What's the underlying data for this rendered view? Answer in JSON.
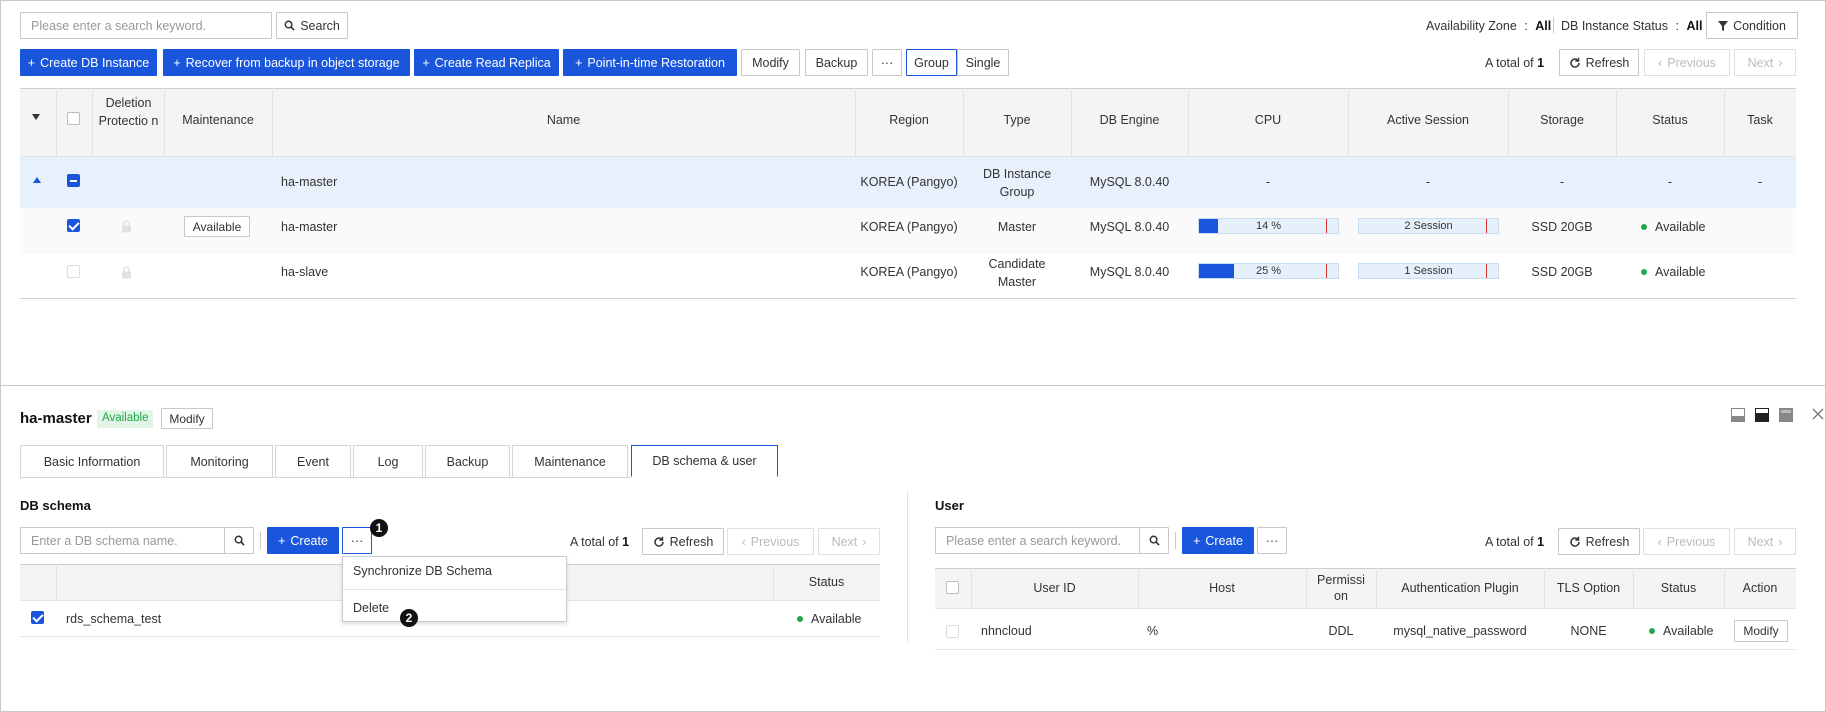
{
  "toolbar": {
    "search_placeholder": "Please enter a search keyword.",
    "search_label": "Search",
    "az_label": "Availability Zone",
    "az_value": "All",
    "status_filter_label": "DB Instance Status",
    "status_filter_value": "All",
    "condition_label": "Condition",
    "sep": ":",
    "create_db_instance": "Create DB Instance",
    "recover_backup": "Recover from backup in object storage",
    "create_read_replica": "Create Read Replica",
    "pitr": "Point-in-time Restoration",
    "modify": "Modify",
    "backup": "Backup",
    "more": "···",
    "group": "Group",
    "single": "Single",
    "total_prefix": "A total of",
    "total_count": "1",
    "refresh": "Refresh",
    "previous": "Previous",
    "next": "Next"
  },
  "table": {
    "headers": {
      "deletion_protection": "Deletion Protectio n",
      "maintenance": "Maintenance",
      "name": "Name",
      "region": "Region",
      "type": "Type",
      "db_engine": "DB Engine",
      "cpu": "CPU",
      "active_session": "Active Session",
      "storage": "Storage",
      "status": "Status",
      "task": "Task"
    },
    "group_row": {
      "name": "ha-master",
      "region": "KOREA (Pangyo)",
      "type": "DB Instance Group",
      "engine": "MySQL 8.0.40",
      "cpu": "-",
      "session": "-",
      "storage": "-",
      "status": "-",
      "task": "-"
    },
    "rows": [
      {
        "maintenance": "Available",
        "name": "ha-master",
        "region": "KOREA (Pangyo)",
        "type": "Master",
        "engine": "MySQL 8.0.40",
        "cpu_label": "14 %",
        "cpu_value": 14,
        "session_label": "2 Session",
        "session_value": 2,
        "storage": "SSD 20GB",
        "status": "Available",
        "checked": true
      },
      {
        "maintenance": "",
        "name": "ha-slave",
        "region": "KOREA (Pangyo)",
        "type": "Candidate Master",
        "engine": "MySQL 8.0.40",
        "cpu_label": "25 %",
        "cpu_value": 25,
        "session_label": "1 Session",
        "session_value": 1,
        "storage": "SSD 20GB",
        "status": "Available",
        "checked": false
      }
    ]
  },
  "detail": {
    "title": "ha-master",
    "status_badge": "Available",
    "modify": "Modify",
    "tabs": [
      "Basic Information",
      "Monitoring",
      "Event",
      "Log",
      "Backup",
      "Maintenance",
      "DB schema & user"
    ],
    "active_tab": 6
  },
  "schema": {
    "section_title": "DB schema",
    "placeholder": "Enter a DB schema name.",
    "create": "Create",
    "more": "···",
    "total_prefix": "A total of",
    "total_count": "1",
    "refresh": "Refresh",
    "previous": "Previous",
    "next": "Next",
    "col_status": "Status",
    "row_name": "rds_schema_test",
    "row_status": "Available",
    "menu": [
      "Synchronize DB Schema",
      "Delete"
    ],
    "callouts": [
      "1",
      "2"
    ]
  },
  "user": {
    "section_title": "User",
    "placeholder": "Please enter a search keyword.",
    "create": "Create",
    "more": "···",
    "total_prefix": "A total of",
    "total_count": "1",
    "refresh": "Refresh",
    "previous": "Previous",
    "next": "Next",
    "headers": {
      "user_id": "User ID",
      "host": "Host",
      "permission": "Permissi on",
      "auth_plugin": "Authentication Plugin",
      "tls": "TLS Option",
      "status": "Status",
      "action": "Action"
    },
    "row": {
      "user_id": "nhncloud",
      "host": "%",
      "permission": "DDL",
      "auth_plugin": "mysql_native_password",
      "tls": "NONE",
      "status": "Available",
      "action": "Modify"
    }
  },
  "colors": {
    "primary": "#1a56db",
    "status_green": "#22a84a",
    "row_highlight": "#e8f0fb"
  }
}
